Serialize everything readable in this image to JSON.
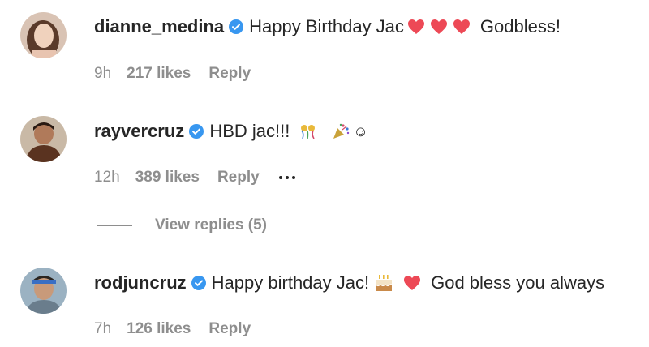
{
  "comments": [
    {
      "username": "dianne_medina",
      "text_before": "Happy Birthday Jac",
      "text_after": "Godbless!",
      "time": "9h",
      "likes": "217 likes",
      "reply": "Reply",
      "avatar_icon": "avatar-photo-woman",
      "verified_icon": "verified-badge-icon"
    },
    {
      "username": "rayvercruz",
      "text_before": "HBD jac!!!",
      "text_after": "☺",
      "time": "12h",
      "likes": "389 likes",
      "reply": "Reply",
      "avatar_icon": "avatar-photo-man",
      "verified_icon": "verified-badge-icon"
    },
    {
      "username": "rodjuncruz",
      "text_before": "Happy birthday Jac!",
      "text_after": "God bless you always",
      "time": "7h",
      "likes": "126 likes",
      "reply": "Reply",
      "avatar_icon": "avatar-photo-man-blue",
      "verified_icon": "verified-badge-icon"
    }
  ],
  "view_replies": "View replies (5)",
  "colors": {
    "verified": "#3897f0",
    "heart": "#ed4956",
    "meta_text": "#8e8e8e",
    "primary_text": "#262626"
  }
}
